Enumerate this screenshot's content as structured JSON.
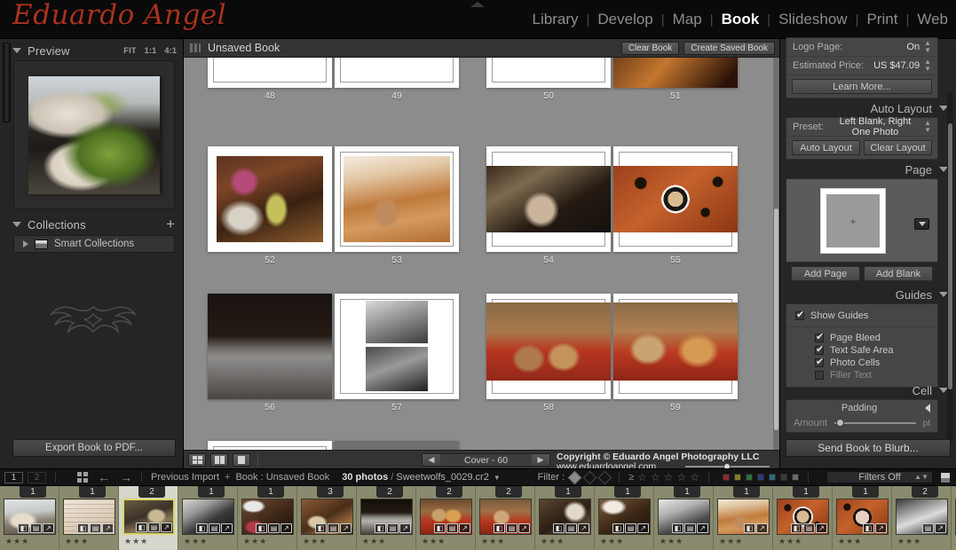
{
  "app": {
    "logo_text": "Eduardo Angel",
    "collapse_icon": "triangle-up-icon"
  },
  "module_nav": {
    "items": [
      {
        "label": "Library",
        "active": false
      },
      {
        "label": "Develop",
        "active": false
      },
      {
        "label": "Map",
        "active": false
      },
      {
        "label": "Book",
        "active": true
      },
      {
        "label": "Slideshow",
        "active": false
      },
      {
        "label": "Print",
        "active": false
      },
      {
        "label": "Web",
        "active": false
      }
    ],
    "separator": "|"
  },
  "left_panel": {
    "preview": {
      "title": "Preview",
      "zoom_levels": [
        "FIT",
        "1:1",
        "4:1"
      ],
      "twisty_icon": "triangle-down-icon"
    },
    "collections": {
      "title": "Collections",
      "add_icon": "plus-icon",
      "items": [
        {
          "label": "Smart Collections",
          "icon": "collection-icon",
          "twisty": "triangle-right-icon"
        }
      ]
    },
    "identity_plate_icon": "tribal-ornament-icon",
    "export_button": "Export Book to PDF..."
  },
  "book_strip": {
    "grip_icon": "drag-grip-icon",
    "title": "Unsaved Book",
    "clear_button": "Clear Book",
    "create_button": "Create Saved Book"
  },
  "book_canvas": {
    "spreads": [
      {
        "row": 0,
        "pages": [
          {
            "number": "48",
            "kind": "blank"
          },
          {
            "number": "49",
            "kind": "blank"
          },
          {
            "number": "50",
            "kind": "blank"
          },
          {
            "number": "51",
            "kind": "photo"
          }
        ]
      },
      {
        "row": 1,
        "pages": [
          {
            "number": "52",
            "kind": "photo"
          },
          {
            "number": "53",
            "kind": "photo"
          },
          {
            "number": "54",
            "kind": "photo"
          },
          {
            "number": "55",
            "kind": "photo"
          }
        ]
      },
      {
        "row": 2,
        "pages": [
          {
            "number": "56",
            "kind": "photo"
          },
          {
            "number": "57",
            "kind": "photo"
          },
          {
            "number": "58",
            "kind": "photo"
          },
          {
            "number": "59",
            "kind": "photo"
          }
        ]
      }
    ]
  },
  "center_toolbar": {
    "view_modes": [
      {
        "name": "multi-page-view",
        "glyph": "grid-2x2"
      },
      {
        "name": "spread-view",
        "glyph": "two-up"
      },
      {
        "name": "single-page-view",
        "glyph": "one-up"
      }
    ],
    "page_nav": {
      "prev_icon": "chevron-left-icon",
      "label": "Cover - 60",
      "next_icon": "chevron-right-icon"
    },
    "copyright_line1": "Copyright © Eduardo Angel Photography LLC",
    "copyright_line2": "www.eduardoangel.com",
    "zoom_slider_value": 45
  },
  "right_panel": {
    "book_settings": {
      "logo_page": {
        "label": "Logo Page:",
        "value": "On"
      },
      "estimated_price": {
        "label": "Estimated Price:",
        "value": "US $47.09"
      },
      "learn_more_button": "Learn More..."
    },
    "auto_layout": {
      "title": "Auto Layout",
      "preset_label": "Preset:",
      "preset_value": "Left Blank, Right One Photo",
      "auto_layout_button": "Auto Layout",
      "clear_layout_button": "Clear Layout"
    },
    "page": {
      "title": "Page",
      "placeholder_glyph": "+",
      "dropdown_icon": "chevron-down-icon",
      "add_page_button": "Add Page",
      "add_blank_button": "Add Blank"
    },
    "guides": {
      "title": "Guides",
      "show_guides": {
        "label": "Show Guides",
        "checked": true
      },
      "options": [
        {
          "label": "Page Bleed",
          "checked": true
        },
        {
          "label": "Text Safe Area",
          "checked": true
        },
        {
          "label": "Photo Cells",
          "checked": true
        },
        {
          "label": "Filler Text",
          "checked": false
        }
      ]
    },
    "cell": {
      "title": "Cell",
      "padding_label": "Padding",
      "padding_twisty": "triangle-left-icon",
      "amount_label": "Amount",
      "amount_value": "",
      "amount_unit": "pt"
    },
    "send_button": "Send Book to Blurb..."
  },
  "filmstrip_bar": {
    "source_buttons": [
      "1",
      "2"
    ],
    "grid_icon": "grid-icon",
    "back_icon": "arrow-left-icon",
    "forward_icon": "arrow-right-icon",
    "breadcrumb_previous": "Previous Import",
    "breadcrumb_plus": "+",
    "breadcrumb_book": "Book : Unsaved Book",
    "photo_count": "30 photos",
    "separator": "/",
    "current_file": "Sweetwolfs_0029.cr2",
    "file_dropdown_icon": "chevron-down-icon",
    "filter_label": "Filter :",
    "flags": [
      "flag-pick-icon",
      "flag-unflagged-icon",
      "flag-reject-icon"
    ],
    "rating_operator": "≥",
    "stars": [
      "star-icon",
      "star-icon",
      "star-icon",
      "star-icon",
      "star-icon"
    ],
    "color_labels": [
      "#8a2b2b",
      "#7d7d2b",
      "#2b6e3c",
      "#2b3f7d",
      "#2b6e7d",
      "#3a3a3a",
      "#6a6a6a"
    ],
    "filters_off_label": "Filters Off",
    "lock_icon": "padlock-icon"
  },
  "filmstrip": {
    "badge_icons": [
      "crop-badge-icon",
      "metadata-badge-icon",
      "develop-badge-icon"
    ],
    "thumbnails": [
      {
        "badge": "1",
        "stars": "★★★",
        "selected": false,
        "style": "plate-bright"
      },
      {
        "badge": "1",
        "stars": "★★★",
        "selected": false,
        "style": "paper-script"
      },
      {
        "badge": "2",
        "stars": "★★★",
        "selected": true,
        "style": "cafe-counter"
      },
      {
        "badge": "1",
        "stars": "★★★",
        "selected": false,
        "style": "bw-window"
      },
      {
        "badge": "1",
        "stars": "★★★",
        "selected": false,
        "style": "shop-front"
      },
      {
        "badge": "3",
        "stars": "★★★",
        "selected": false,
        "style": "bar-warm"
      },
      {
        "badge": "2",
        "stars": "★★★",
        "selected": false,
        "style": "dark-counter"
      },
      {
        "badge": "2",
        "stars": "★★★",
        "selected": false,
        "style": "red-bowls"
      },
      {
        "badge": "2",
        "stars": "★★★",
        "selected": false,
        "style": "red-bowls2"
      },
      {
        "badge": "1",
        "stars": "★★★",
        "selected": false,
        "style": "interior"
      },
      {
        "badge": "1",
        "stars": "★★★",
        "selected": false,
        "style": "storefront"
      },
      {
        "badge": "1",
        "stars": "★★★",
        "selected": false,
        "style": "bw-grinders"
      },
      {
        "badge": "1",
        "stars": "★★★",
        "selected": false,
        "style": "motion-cup"
      },
      {
        "badge": "1",
        "stars": "★★★",
        "selected": false,
        "style": "latte-top"
      },
      {
        "badge": "1",
        "stars": "★★★",
        "selected": false,
        "style": "latte-cup"
      },
      {
        "badge": "2",
        "stars": "★★★",
        "selected": false,
        "style": "bw-machine"
      },
      {
        "badge": "",
        "stars": "",
        "selected": false,
        "style": "edge"
      }
    ]
  }
}
